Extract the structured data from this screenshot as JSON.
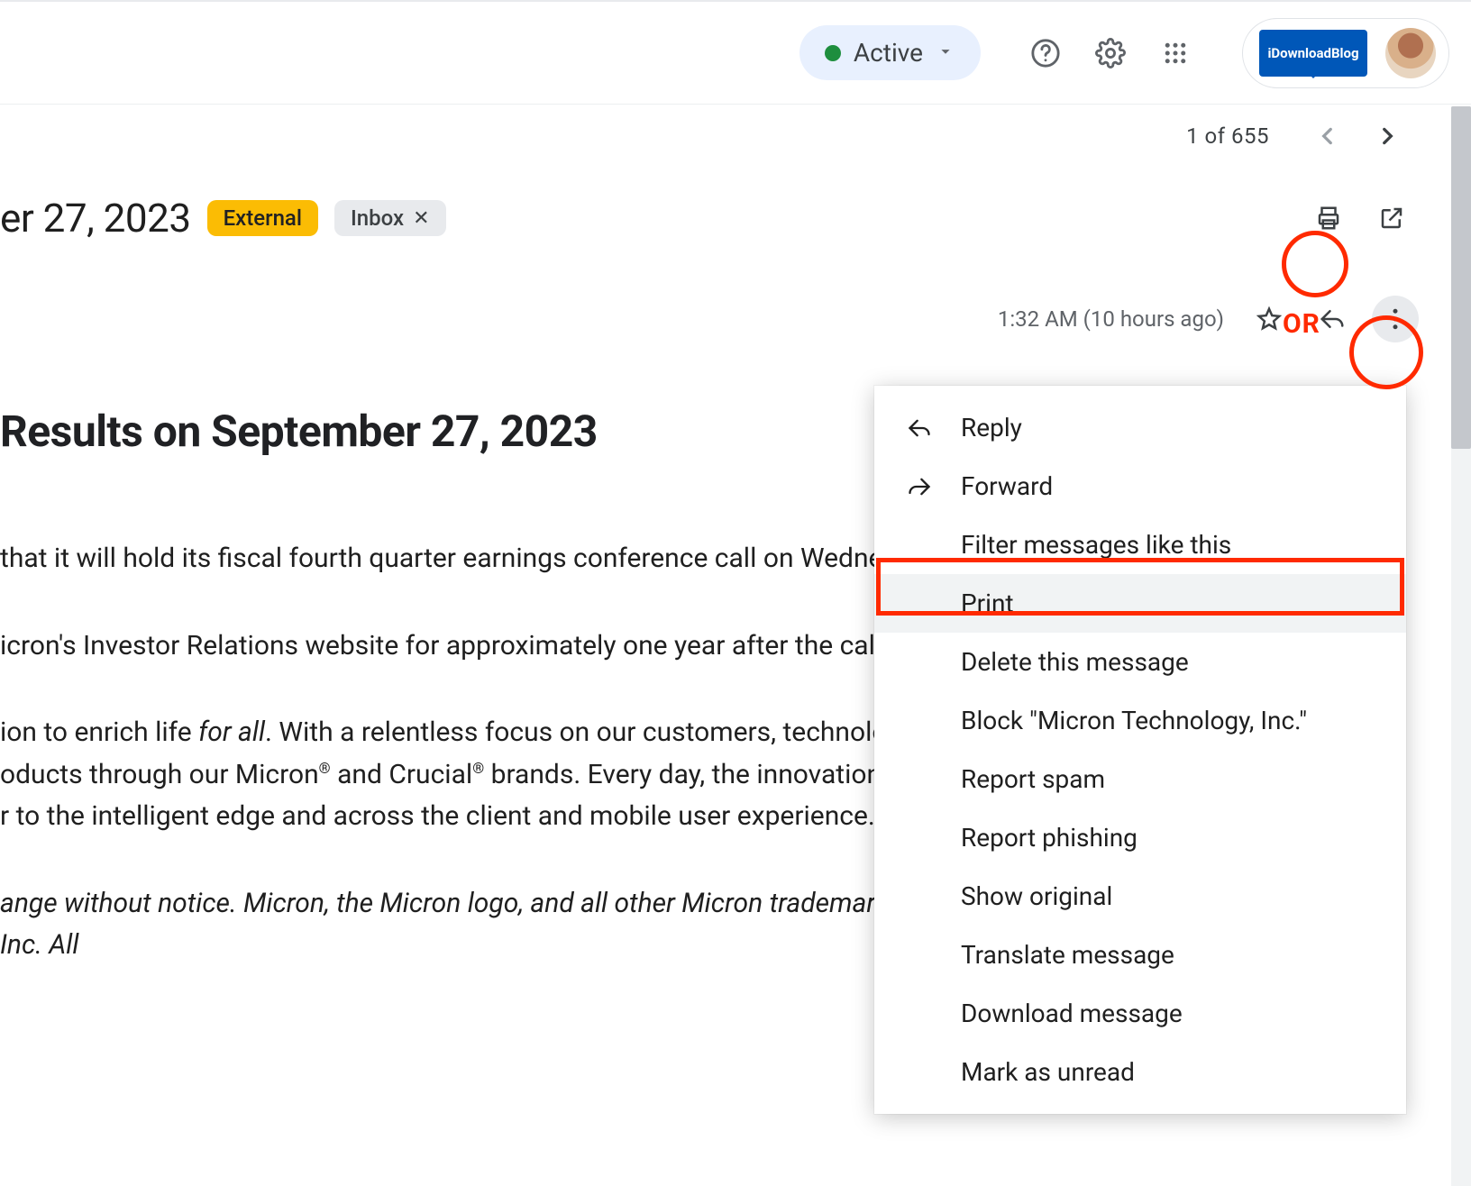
{
  "header": {
    "status_label": "Active",
    "brand_text": "iDownloadBlog"
  },
  "pager": {
    "text": "1 of 655"
  },
  "title": {
    "fragment": "er 27, 2023",
    "chip_external": "External",
    "chip_inbox": "Inbox"
  },
  "meta": {
    "timestamp": "1:32 AM (10 hours ago)"
  },
  "annotations": {
    "or_label": "OR"
  },
  "menu": {
    "reply": "Reply",
    "forward": "Forward",
    "filter": "Filter messages like this",
    "print": "Print",
    "delete": "Delete this message",
    "block": "Block \"Micron Technology, Inc.\"",
    "report_spam": "Report spam",
    "report_phishing": "Report phishing",
    "show_original": "Show original",
    "translate": "Translate message",
    "download": "Download message",
    "mark_unread": "Mark as unread"
  },
  "body": {
    "heading": "Results on September 27, 2023",
    "p1": " that it will hold its fiscal fourth quarter earnings conference call on Wednesday,",
    "p2": "icron's Investor Relations website for approximately one year after the call.",
    "p3_pre": "ion to enrich life ",
    "p3_em": "for all",
    "p3_post1": ". With a relentless focus on our customers, technology le",
    "p3_line2a": "oducts through our Micron",
    "p3_line2b": " and Crucial",
    "p3_line2c": " brands. Every day, the innovations th",
    "p3_line3": "r to the intelligent edge and across the client and mobile user experience. To le",
    "disclaimer": "ange without notice. Micron, the Micron logo, and all other Micron trademarks are the property of Micron Technology, Inc. All"
  }
}
